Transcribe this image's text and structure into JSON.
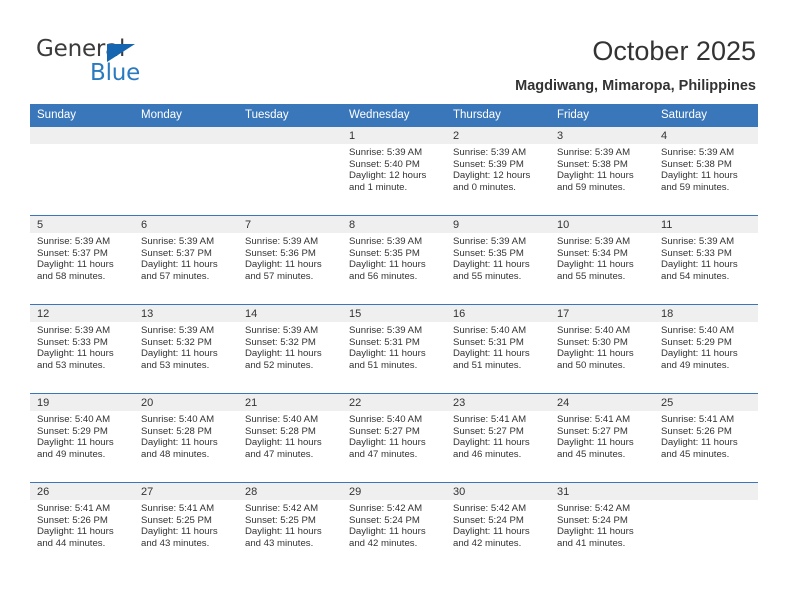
{
  "brand": {
    "name_top": "General",
    "name_bottom": "Blue",
    "triangle_color": "#1565b0",
    "blue_text_color": "#2a7ac0",
    "gray_text_color": "#3b3b3b"
  },
  "header": {
    "title": "October 2025",
    "subtitle": "Magdiwang, Mimaropa, Philippines"
  },
  "theme": {
    "header_blue": "#3a77ba",
    "daynum_band": "#efefef",
    "text": "#333333"
  },
  "weekday_headers": [
    "Sunday",
    "Monday",
    "Tuesday",
    "Wednesday",
    "Thursday",
    "Friday",
    "Saturday"
  ],
  "weeks": [
    [
      {
        "day": "",
        "blank": true
      },
      {
        "day": "",
        "blank": true
      },
      {
        "day": "",
        "blank": true
      },
      {
        "day": "1",
        "sunrise": "Sunrise: 5:39 AM",
        "sunset": "Sunset: 5:40 PM",
        "daylight1": "Daylight: 12 hours",
        "daylight2": "and 1 minute."
      },
      {
        "day": "2",
        "sunrise": "Sunrise: 5:39 AM",
        "sunset": "Sunset: 5:39 PM",
        "daylight1": "Daylight: 12 hours",
        "daylight2": "and 0 minutes."
      },
      {
        "day": "3",
        "sunrise": "Sunrise: 5:39 AM",
        "sunset": "Sunset: 5:38 PM",
        "daylight1": "Daylight: 11 hours",
        "daylight2": "and 59 minutes."
      },
      {
        "day": "4",
        "sunrise": "Sunrise: 5:39 AM",
        "sunset": "Sunset: 5:38 PM",
        "daylight1": "Daylight: 11 hours",
        "daylight2": "and 59 minutes."
      }
    ],
    [
      {
        "day": "5",
        "sunrise": "Sunrise: 5:39 AM",
        "sunset": "Sunset: 5:37 PM",
        "daylight1": "Daylight: 11 hours",
        "daylight2": "and 58 minutes."
      },
      {
        "day": "6",
        "sunrise": "Sunrise: 5:39 AM",
        "sunset": "Sunset: 5:37 PM",
        "daylight1": "Daylight: 11 hours",
        "daylight2": "and 57 minutes."
      },
      {
        "day": "7",
        "sunrise": "Sunrise: 5:39 AM",
        "sunset": "Sunset: 5:36 PM",
        "daylight1": "Daylight: 11 hours",
        "daylight2": "and 57 minutes."
      },
      {
        "day": "8",
        "sunrise": "Sunrise: 5:39 AM",
        "sunset": "Sunset: 5:35 PM",
        "daylight1": "Daylight: 11 hours",
        "daylight2": "and 56 minutes."
      },
      {
        "day": "9",
        "sunrise": "Sunrise: 5:39 AM",
        "sunset": "Sunset: 5:35 PM",
        "daylight1": "Daylight: 11 hours",
        "daylight2": "and 55 minutes."
      },
      {
        "day": "10",
        "sunrise": "Sunrise: 5:39 AM",
        "sunset": "Sunset: 5:34 PM",
        "daylight1": "Daylight: 11 hours",
        "daylight2": "and 55 minutes."
      },
      {
        "day": "11",
        "sunrise": "Sunrise: 5:39 AM",
        "sunset": "Sunset: 5:33 PM",
        "daylight1": "Daylight: 11 hours",
        "daylight2": "and 54 minutes."
      }
    ],
    [
      {
        "day": "12",
        "sunrise": "Sunrise: 5:39 AM",
        "sunset": "Sunset: 5:33 PM",
        "daylight1": "Daylight: 11 hours",
        "daylight2": "and 53 minutes."
      },
      {
        "day": "13",
        "sunrise": "Sunrise: 5:39 AM",
        "sunset": "Sunset: 5:32 PM",
        "daylight1": "Daylight: 11 hours",
        "daylight2": "and 53 minutes."
      },
      {
        "day": "14",
        "sunrise": "Sunrise: 5:39 AM",
        "sunset": "Sunset: 5:32 PM",
        "daylight1": "Daylight: 11 hours",
        "daylight2": "and 52 minutes."
      },
      {
        "day": "15",
        "sunrise": "Sunrise: 5:39 AM",
        "sunset": "Sunset: 5:31 PM",
        "daylight1": "Daylight: 11 hours",
        "daylight2": "and 51 minutes."
      },
      {
        "day": "16",
        "sunrise": "Sunrise: 5:40 AM",
        "sunset": "Sunset: 5:31 PM",
        "daylight1": "Daylight: 11 hours",
        "daylight2": "and 51 minutes."
      },
      {
        "day": "17",
        "sunrise": "Sunrise: 5:40 AM",
        "sunset": "Sunset: 5:30 PM",
        "daylight1": "Daylight: 11 hours",
        "daylight2": "and 50 minutes."
      },
      {
        "day": "18",
        "sunrise": "Sunrise: 5:40 AM",
        "sunset": "Sunset: 5:29 PM",
        "daylight1": "Daylight: 11 hours",
        "daylight2": "and 49 minutes."
      }
    ],
    [
      {
        "day": "19",
        "sunrise": "Sunrise: 5:40 AM",
        "sunset": "Sunset: 5:29 PM",
        "daylight1": "Daylight: 11 hours",
        "daylight2": "and 49 minutes."
      },
      {
        "day": "20",
        "sunrise": "Sunrise: 5:40 AM",
        "sunset": "Sunset: 5:28 PM",
        "daylight1": "Daylight: 11 hours",
        "daylight2": "and 48 minutes."
      },
      {
        "day": "21",
        "sunrise": "Sunrise: 5:40 AM",
        "sunset": "Sunset: 5:28 PM",
        "daylight1": "Daylight: 11 hours",
        "daylight2": "and 47 minutes."
      },
      {
        "day": "22",
        "sunrise": "Sunrise: 5:40 AM",
        "sunset": "Sunset: 5:27 PM",
        "daylight1": "Daylight: 11 hours",
        "daylight2": "and 47 minutes."
      },
      {
        "day": "23",
        "sunrise": "Sunrise: 5:41 AM",
        "sunset": "Sunset: 5:27 PM",
        "daylight1": "Daylight: 11 hours",
        "daylight2": "and 46 minutes."
      },
      {
        "day": "24",
        "sunrise": "Sunrise: 5:41 AM",
        "sunset": "Sunset: 5:27 PM",
        "daylight1": "Daylight: 11 hours",
        "daylight2": "and 45 minutes."
      },
      {
        "day": "25",
        "sunrise": "Sunrise: 5:41 AM",
        "sunset": "Sunset: 5:26 PM",
        "daylight1": "Daylight: 11 hours",
        "daylight2": "and 45 minutes."
      }
    ],
    [
      {
        "day": "26",
        "sunrise": "Sunrise: 5:41 AM",
        "sunset": "Sunset: 5:26 PM",
        "daylight1": "Daylight: 11 hours",
        "daylight2": "and 44 minutes."
      },
      {
        "day": "27",
        "sunrise": "Sunrise: 5:41 AM",
        "sunset": "Sunset: 5:25 PM",
        "daylight1": "Daylight: 11 hours",
        "daylight2": "and 43 minutes."
      },
      {
        "day": "28",
        "sunrise": "Sunrise: 5:42 AM",
        "sunset": "Sunset: 5:25 PM",
        "daylight1": "Daylight: 11 hours",
        "daylight2": "and 43 minutes."
      },
      {
        "day": "29",
        "sunrise": "Sunrise: 5:42 AM",
        "sunset": "Sunset: 5:24 PM",
        "daylight1": "Daylight: 11 hours",
        "daylight2": "and 42 minutes."
      },
      {
        "day": "30",
        "sunrise": "Sunrise: 5:42 AM",
        "sunset": "Sunset: 5:24 PM",
        "daylight1": "Daylight: 11 hours",
        "daylight2": "and 42 minutes."
      },
      {
        "day": "31",
        "sunrise": "Sunrise: 5:42 AM",
        "sunset": "Sunset: 5:24 PM",
        "daylight1": "Daylight: 11 hours",
        "daylight2": "and 41 minutes."
      },
      {
        "day": "",
        "blank": true
      }
    ]
  ]
}
